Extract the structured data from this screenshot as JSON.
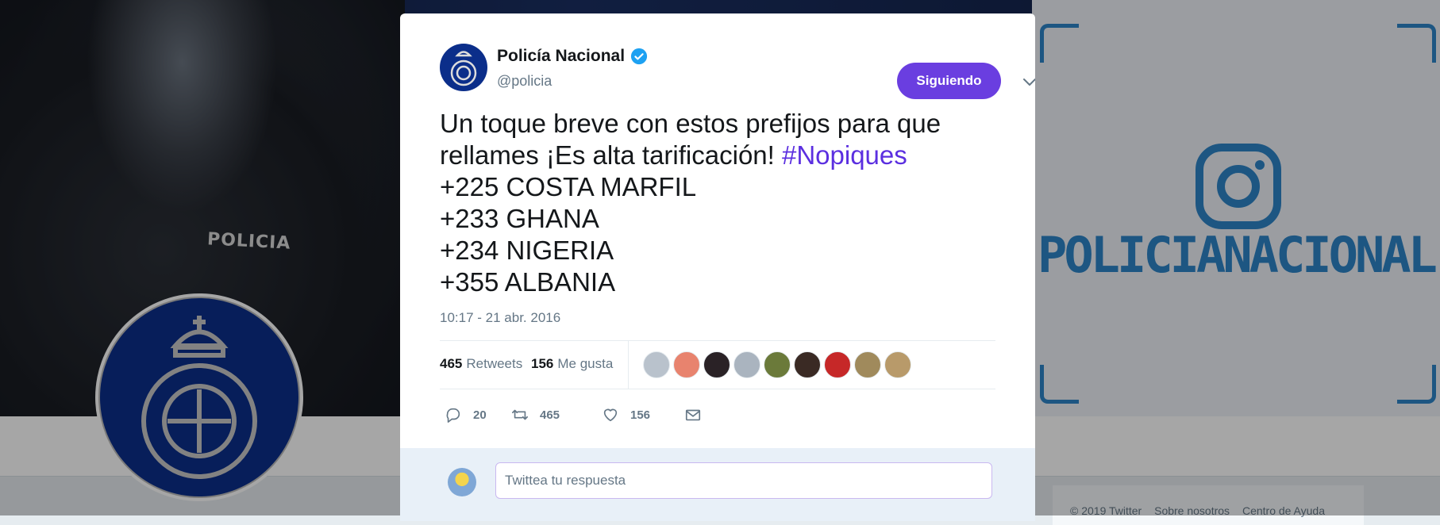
{
  "background": {
    "patch_text": "POLICIA",
    "instagram_handle": "POLICIANACIONAL",
    "footer_links": [
      "© 2019 Twitter",
      "Sobre nosotros",
      "Centro de Ayuda"
    ]
  },
  "tweet": {
    "author": {
      "name": "Policía Nacional",
      "handle": "@policia",
      "verified": true
    },
    "follow_label": "Siguiendo",
    "text_lines": [
      "Un toque breve con estos prefijos para que",
      "rellames ¡Es alta tarificación! ",
      "+225 COSTA MARFIL",
      "+233 GHANA",
      "+234 NIGERIA",
      "+355 ALBANIA"
    ],
    "hashtag": "#Nopiques",
    "timestamp": "10:17 - 21 abr. 2016",
    "stats": {
      "retweets_count": "465",
      "retweets_label": "Retweets",
      "likes_count": "156",
      "likes_label": "Me gusta"
    },
    "liker_colors": [
      "#b9c2cc",
      "#e8836e",
      "#2a2226",
      "#aab4bf",
      "#6b7a3a",
      "#3a2a24",
      "#c62828",
      "#a08a5c",
      "#b89a6a"
    ],
    "actions": {
      "reply_count": "20",
      "retweet_count": "465",
      "like_count": "156"
    },
    "reply_placeholder": "Twittea tu respuesta"
  },
  "colors": {
    "accent": "#6a3ee0",
    "hashtag": "#5b2fe0",
    "brand_blue": "#0b2e8a",
    "instagram_blue": "#2d84c8"
  }
}
